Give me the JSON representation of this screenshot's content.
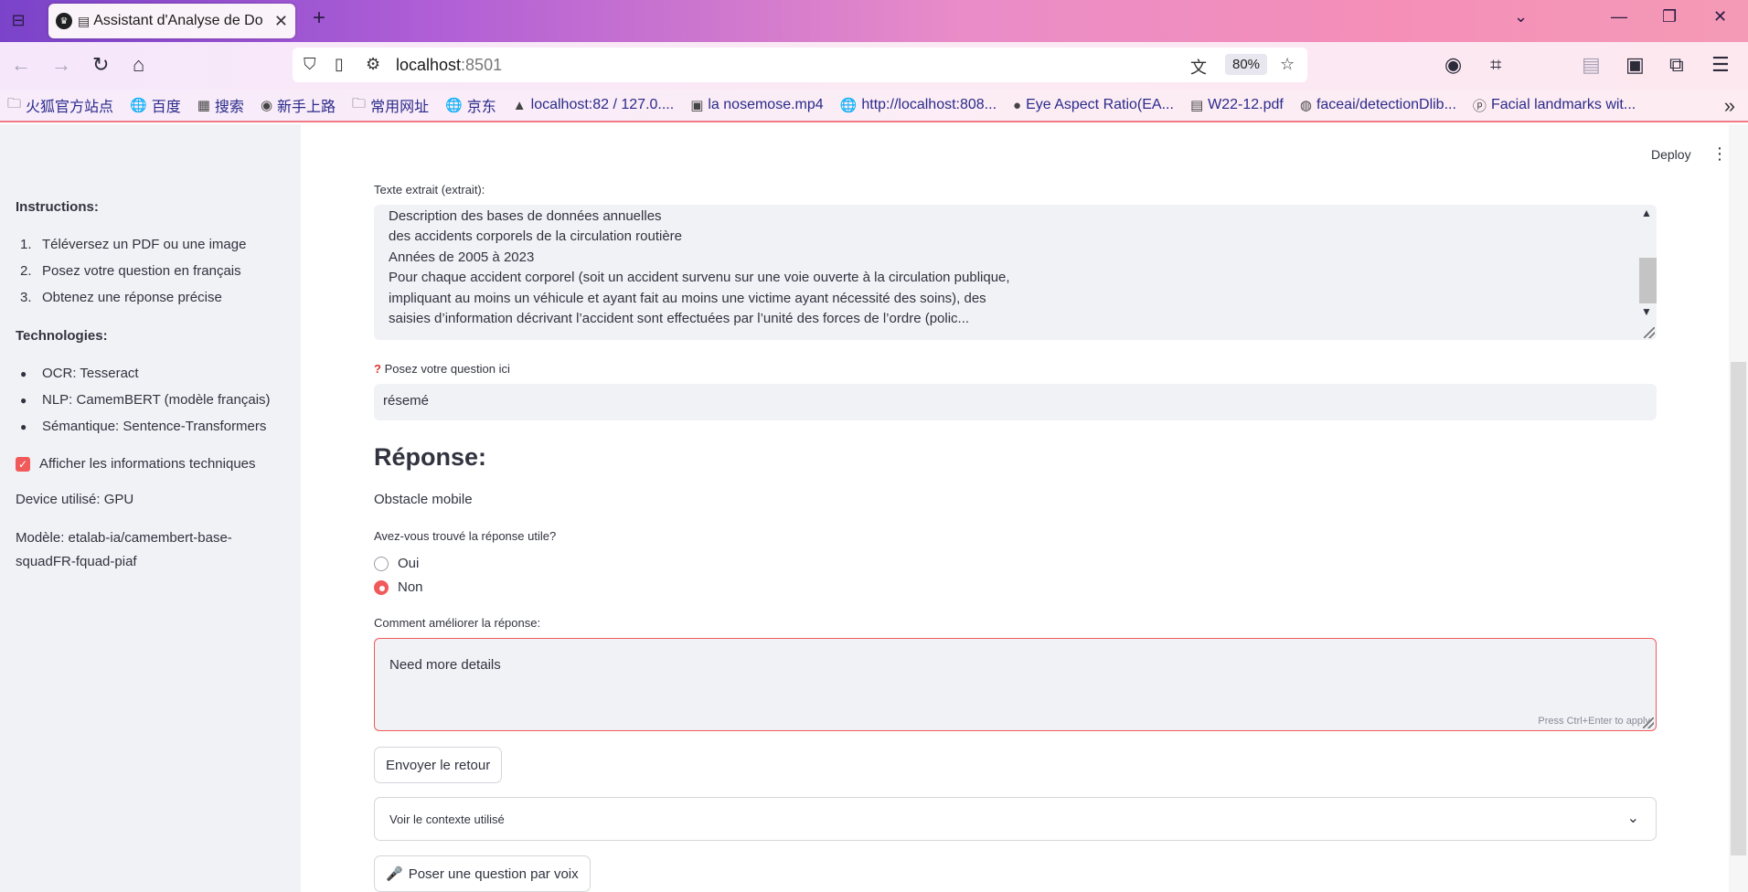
{
  "browser": {
    "tab_title": "Assistant d'Analyse de Do",
    "url_host": "localhost",
    "url_port": ":8501",
    "zoom": "80%",
    "bookmarks": [
      {
        "icon": "folder-icon",
        "glyph": "🗀",
        "label": "火狐官方站点"
      },
      {
        "icon": "globe-icon",
        "glyph": "🌐",
        "label": "百度"
      },
      {
        "icon": "search-favicon",
        "glyph": "▦",
        "label": "搜索"
      },
      {
        "icon": "firefox-icon",
        "glyph": "◉",
        "label": "新手上路"
      },
      {
        "icon": "folder-icon",
        "glyph": "🗀",
        "label": "常用网址"
      },
      {
        "icon": "globe-icon",
        "glyph": "🌐",
        "label": "京东"
      },
      {
        "icon": "pma-icon",
        "glyph": "▲",
        "label": "localhost:82 / 127.0...."
      },
      {
        "icon": "video-icon",
        "glyph": "▣",
        "label": "la nosemose.mp4"
      },
      {
        "icon": "globe-icon",
        "glyph": "🌐",
        "label": "http://localhost:808..."
      },
      {
        "icon": "medium-icon",
        "glyph": "●",
        "label": "Eye Aspect Ratio(EA..."
      },
      {
        "icon": "pdf-icon",
        "glyph": "▤",
        "label": "W22-12.pdf"
      },
      {
        "icon": "github-icon",
        "glyph": "◍",
        "label": "faceai/detectionDlib..."
      },
      {
        "icon": "p-icon",
        "glyph": "ⓟ",
        "label": "Facial landmarks wit..."
      }
    ]
  },
  "sidebar": {
    "instructions_title": "Instructions:",
    "instructions": [
      "Téléversez un PDF ou une image",
      "Posez votre question en français",
      "Obtenez une réponse précise"
    ],
    "tech_title": "Technologies:",
    "technologies": [
      "OCR: Tesseract",
      "NLP: CamemBERT (modèle français)",
      "Sémantique: Sentence-Transformers"
    ],
    "checkbox_label": "Afficher les informations techniques",
    "device": "Device utilisé: GPU",
    "model": "Modèle: etalab-ia/camembert-base-squadFR-fquad-piaf"
  },
  "header": {
    "deploy": "Deploy"
  },
  "main": {
    "extract_label": "Texte extrait (extrait):",
    "extract_lines": [
      "Description des bases de données annuelles",
      "des accidents corporels de la circulation routière",
      "Années de 2005 à 2023",
      "Pour chaque accident corporel (soit un accident survenu sur une voie ouverte à la circulation publique,",
      "impliquant au moins un véhicule et ayant fait au moins une victime ayant nécessité des soins), des",
      "saisies d’information décrivant l’accident sont effectuées par l’unité des forces de l’ordre (polic..."
    ],
    "question_label": "Posez votre question ici",
    "question_value": "résemé",
    "response_heading": "Réponse:",
    "answer": "Obstacle mobile",
    "feedback_question": "Avez-vous trouvé la réponse utile?",
    "options": [
      "Oui",
      "Non"
    ],
    "selected_option": "Non",
    "comment_label": "Comment améliorer la réponse:",
    "comment_value": "Need more details",
    "comment_hint": "Press Ctrl+Enter to apply",
    "send_button": "Envoyer le retour",
    "context_expander": "Voir le contexte utilisé",
    "voice_button": "Poser une question par voix"
  },
  "colors": {
    "accent": "#f15a5a",
    "sidebar_bg": "#f0f2f6",
    "text": "#31333f"
  }
}
